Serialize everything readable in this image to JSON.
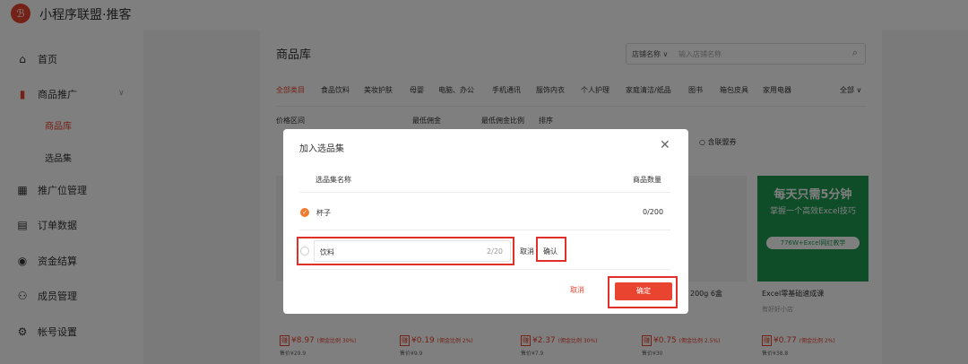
{
  "app": {
    "logo_glyph": "ℬ",
    "brand": "小程序联盟·推客"
  },
  "sidebar": {
    "items": [
      {
        "icon": "⌂",
        "label": "首页"
      },
      {
        "icon": "▮",
        "label": "商品推广"
      },
      {
        "icon": "▦",
        "label": "推广位管理"
      },
      {
        "icon": "▤",
        "label": "订单数据"
      },
      {
        "icon": "◉",
        "label": "资金结算"
      },
      {
        "icon": "⚇",
        "label": "成员管理"
      },
      {
        "icon": "⚙",
        "label": "帐号设置"
      }
    ],
    "sub_items": [
      "商品库",
      "选品集"
    ],
    "chevron": "∨"
  },
  "main": {
    "title": "商品库",
    "search": {
      "select_label": "店铺名称 ∨",
      "placeholder": "输入店铺名称",
      "icon": "⌕"
    },
    "categories": [
      "全部类目",
      "食品饮料",
      "美妆护肤",
      "母婴",
      "电脑、办公",
      "手机通讯",
      "服饰内衣",
      "个人护理",
      "家庭清洁/纸品",
      "图书",
      "箱包皮具",
      "家用电器",
      "全部 ∨"
    ],
    "filters": [
      "价格区间",
      "最低佣金",
      "最低佣金比例",
      "排序"
    ],
    "coupon_option": "含联盟券",
    "products": [
      {
        "name": "",
        "shop": ""
      },
      {
        "name": "",
        "shop": ""
      },
      {
        "name": "",
        "shop": ""
      },
      {
        "name": "200g 6盒",
        "shop": ""
      },
      {
        "name": "Excel零基础速成课",
        "shop": "有好好小店"
      }
    ],
    "excel_card": {
      "line1": "每天只需5分钟",
      "line2": "掌握一个高效Excel技巧",
      "line3": "776W+Excel网红教学"
    },
    "prices": [
      {
        "tag": "赚",
        "amount": "¥8.97",
        "rate": "(佣金比例 30%)",
        "orig": "售价¥29.9"
      },
      {
        "tag": "赚",
        "amount": "¥0.19",
        "rate": "(佣金比例 2%)",
        "orig": "售价¥9.9"
      },
      {
        "tag": "赚",
        "amount": "¥2.37",
        "rate": "(佣金比例 30%)",
        "orig": "售价¥7.9"
      },
      {
        "tag": "赚",
        "amount": "¥0.75",
        "rate": "(佣金比例 2.5%)",
        "orig": "售价¥30"
      },
      {
        "tag": "赚",
        "amount": "¥0.77",
        "rate": "(佣金比例 2%)",
        "orig": "售价¥38.8"
      }
    ]
  },
  "modal": {
    "title": "加入选品集",
    "close_icon": "✕",
    "columns": {
      "name": "选品集名称",
      "count": "商品数量"
    },
    "rows": [
      {
        "check": "✓",
        "name": "杯子",
        "count": "0/200"
      }
    ],
    "new_entry": {
      "value": "饮料",
      "counter": "2/20",
      "cancel": "取消",
      "confirm": "确认"
    },
    "footer": {
      "cancel": "取消",
      "ok": "确定"
    }
  },
  "colors": {
    "accent": "#e8442f",
    "check": "#f07a2d",
    "excel_green": "#1e9a52",
    "annotation": "#e0302a"
  }
}
